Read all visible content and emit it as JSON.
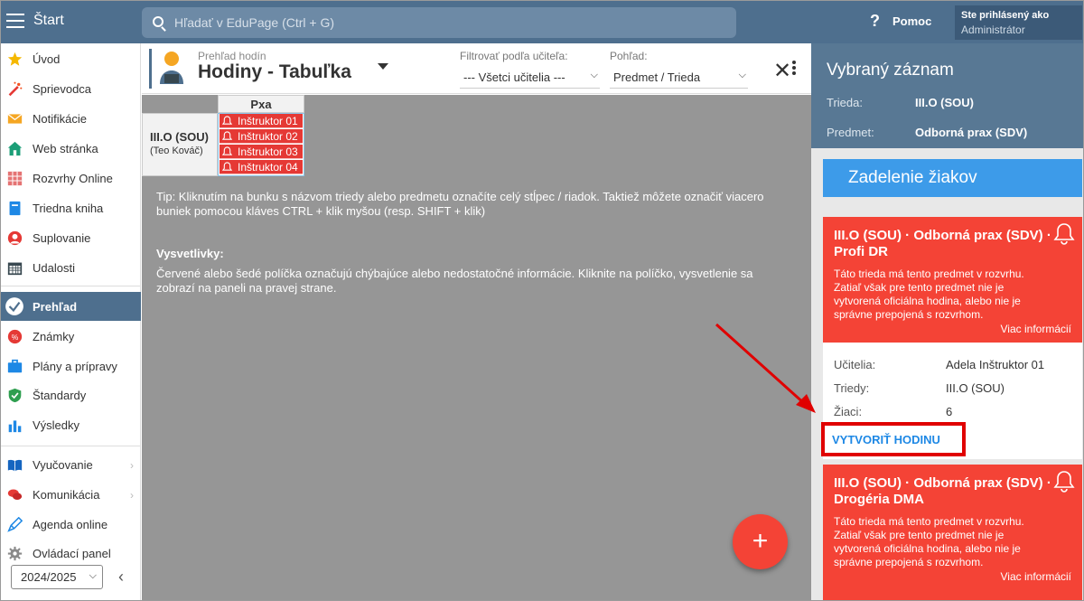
{
  "topbar": {
    "start_label": "Štart",
    "search_placeholder": "Hľadať v EduPage (Ctrl + G)",
    "help_label": "Pomoc",
    "login_line1": "Ste prihlásený ako",
    "login_line2": "Administrátor"
  },
  "sidebar": {
    "items": [
      {
        "label": "Úvod",
        "icon": "star-icon"
      },
      {
        "label": "Sprievodca",
        "icon": "magic-wand-icon"
      },
      {
        "label": "Notifikácie",
        "icon": "envelope-icon"
      },
      {
        "label": "Web stránka",
        "icon": "home-icon"
      },
      {
        "label": "Rozvrhy Online",
        "icon": "grid-icon"
      },
      {
        "label": "Triedna kniha",
        "icon": "book-icon"
      },
      {
        "label": "Suplovanie",
        "icon": "person-icon"
      },
      {
        "label": "Udalosti",
        "icon": "calendar-icon"
      },
      {
        "label": "Prehľad",
        "icon": "check-icon"
      },
      {
        "label": "Známky",
        "icon": "grade-icon"
      },
      {
        "label": "Plány a prípravy",
        "icon": "briefcase-icon"
      },
      {
        "label": "Štandardy",
        "icon": "shield-icon"
      },
      {
        "label": "Výsledky",
        "icon": "bar-chart-icon"
      },
      {
        "label": "Vyučovanie",
        "icon": "open-book-icon"
      },
      {
        "label": "Komunikácia",
        "icon": "chat-icon"
      },
      {
        "label": "Agenda online",
        "icon": "pen-icon"
      },
      {
        "label": "Ovládací panel",
        "icon": "gear-icon"
      }
    ],
    "year": "2024/2025"
  },
  "main": {
    "subtitle": "Prehľad hodín",
    "title": "Hodiny - Tabuľka",
    "filter_label": "Filtrovať podľa učiteľa:",
    "filter_value": "--- Všetci učitelia ---",
    "view_label": "Pohľad:",
    "view_value": "Predmet / Trieda",
    "table": {
      "column": "Pxa",
      "row_class": "III.O (SOU)",
      "row_teacher": "(Teo Kováč)",
      "cells": [
        "Inštruktor 01",
        "Inštruktor 02",
        "Inštruktor 03",
        "Inštruktor 04"
      ]
    },
    "tip": "Tip: Kliknutím na bunku s názvom triedy alebo predmetu označíte celý stĺpec / riadok. Taktiež môžete označiť viacero buniek pomocou kláves CTRL + klik myšou (resp. SHIFT + klik)",
    "legend_title": "Vysvetlivky:",
    "legend_text": "Červené alebo šedé políčka označujú chýbajúce alebo nedostatočné informácie. Kliknite na políčko, vysvetlenie sa zobrazí na paneli na pravej strane.",
    "fab": "+"
  },
  "panel": {
    "title": "Vybraný záznam",
    "class_key": "Trieda:",
    "class_value": "III.O (SOU)",
    "subject_key": "Predmet:",
    "subject_value": "Odborná prax (SDV)",
    "assign_label": "Zadelenie žiakov",
    "alert1_title": "III.O (SOU) · Odborná prax (SDV) · Profi DR",
    "alert_desc": "Táto trieda má tento predmet v rozvrhu. Zatiaľ však pre tento predmet nie je vytvorená oficiálna hodina, alebo nie je správne prepojená s rozvrhom.",
    "more_label": "Viac informácií",
    "teachers_key": "Učitelia:",
    "teachers_value": "Adela Inštruktor 01",
    "classes_key": "Triedy:",
    "classes_value": "III.O (SOU)",
    "students_key": "Žiaci:",
    "students_value": "6",
    "create_label": "VYTVORIŤ HODINU",
    "alert2_title": "III.O (SOU) · Odborná prax (SDV) · Drogéria DMA"
  },
  "colors": {
    "topbar": "#4e6f8e",
    "alert": "#f44336",
    "assign": "#3d9be9",
    "annotation": "#e00000"
  }
}
